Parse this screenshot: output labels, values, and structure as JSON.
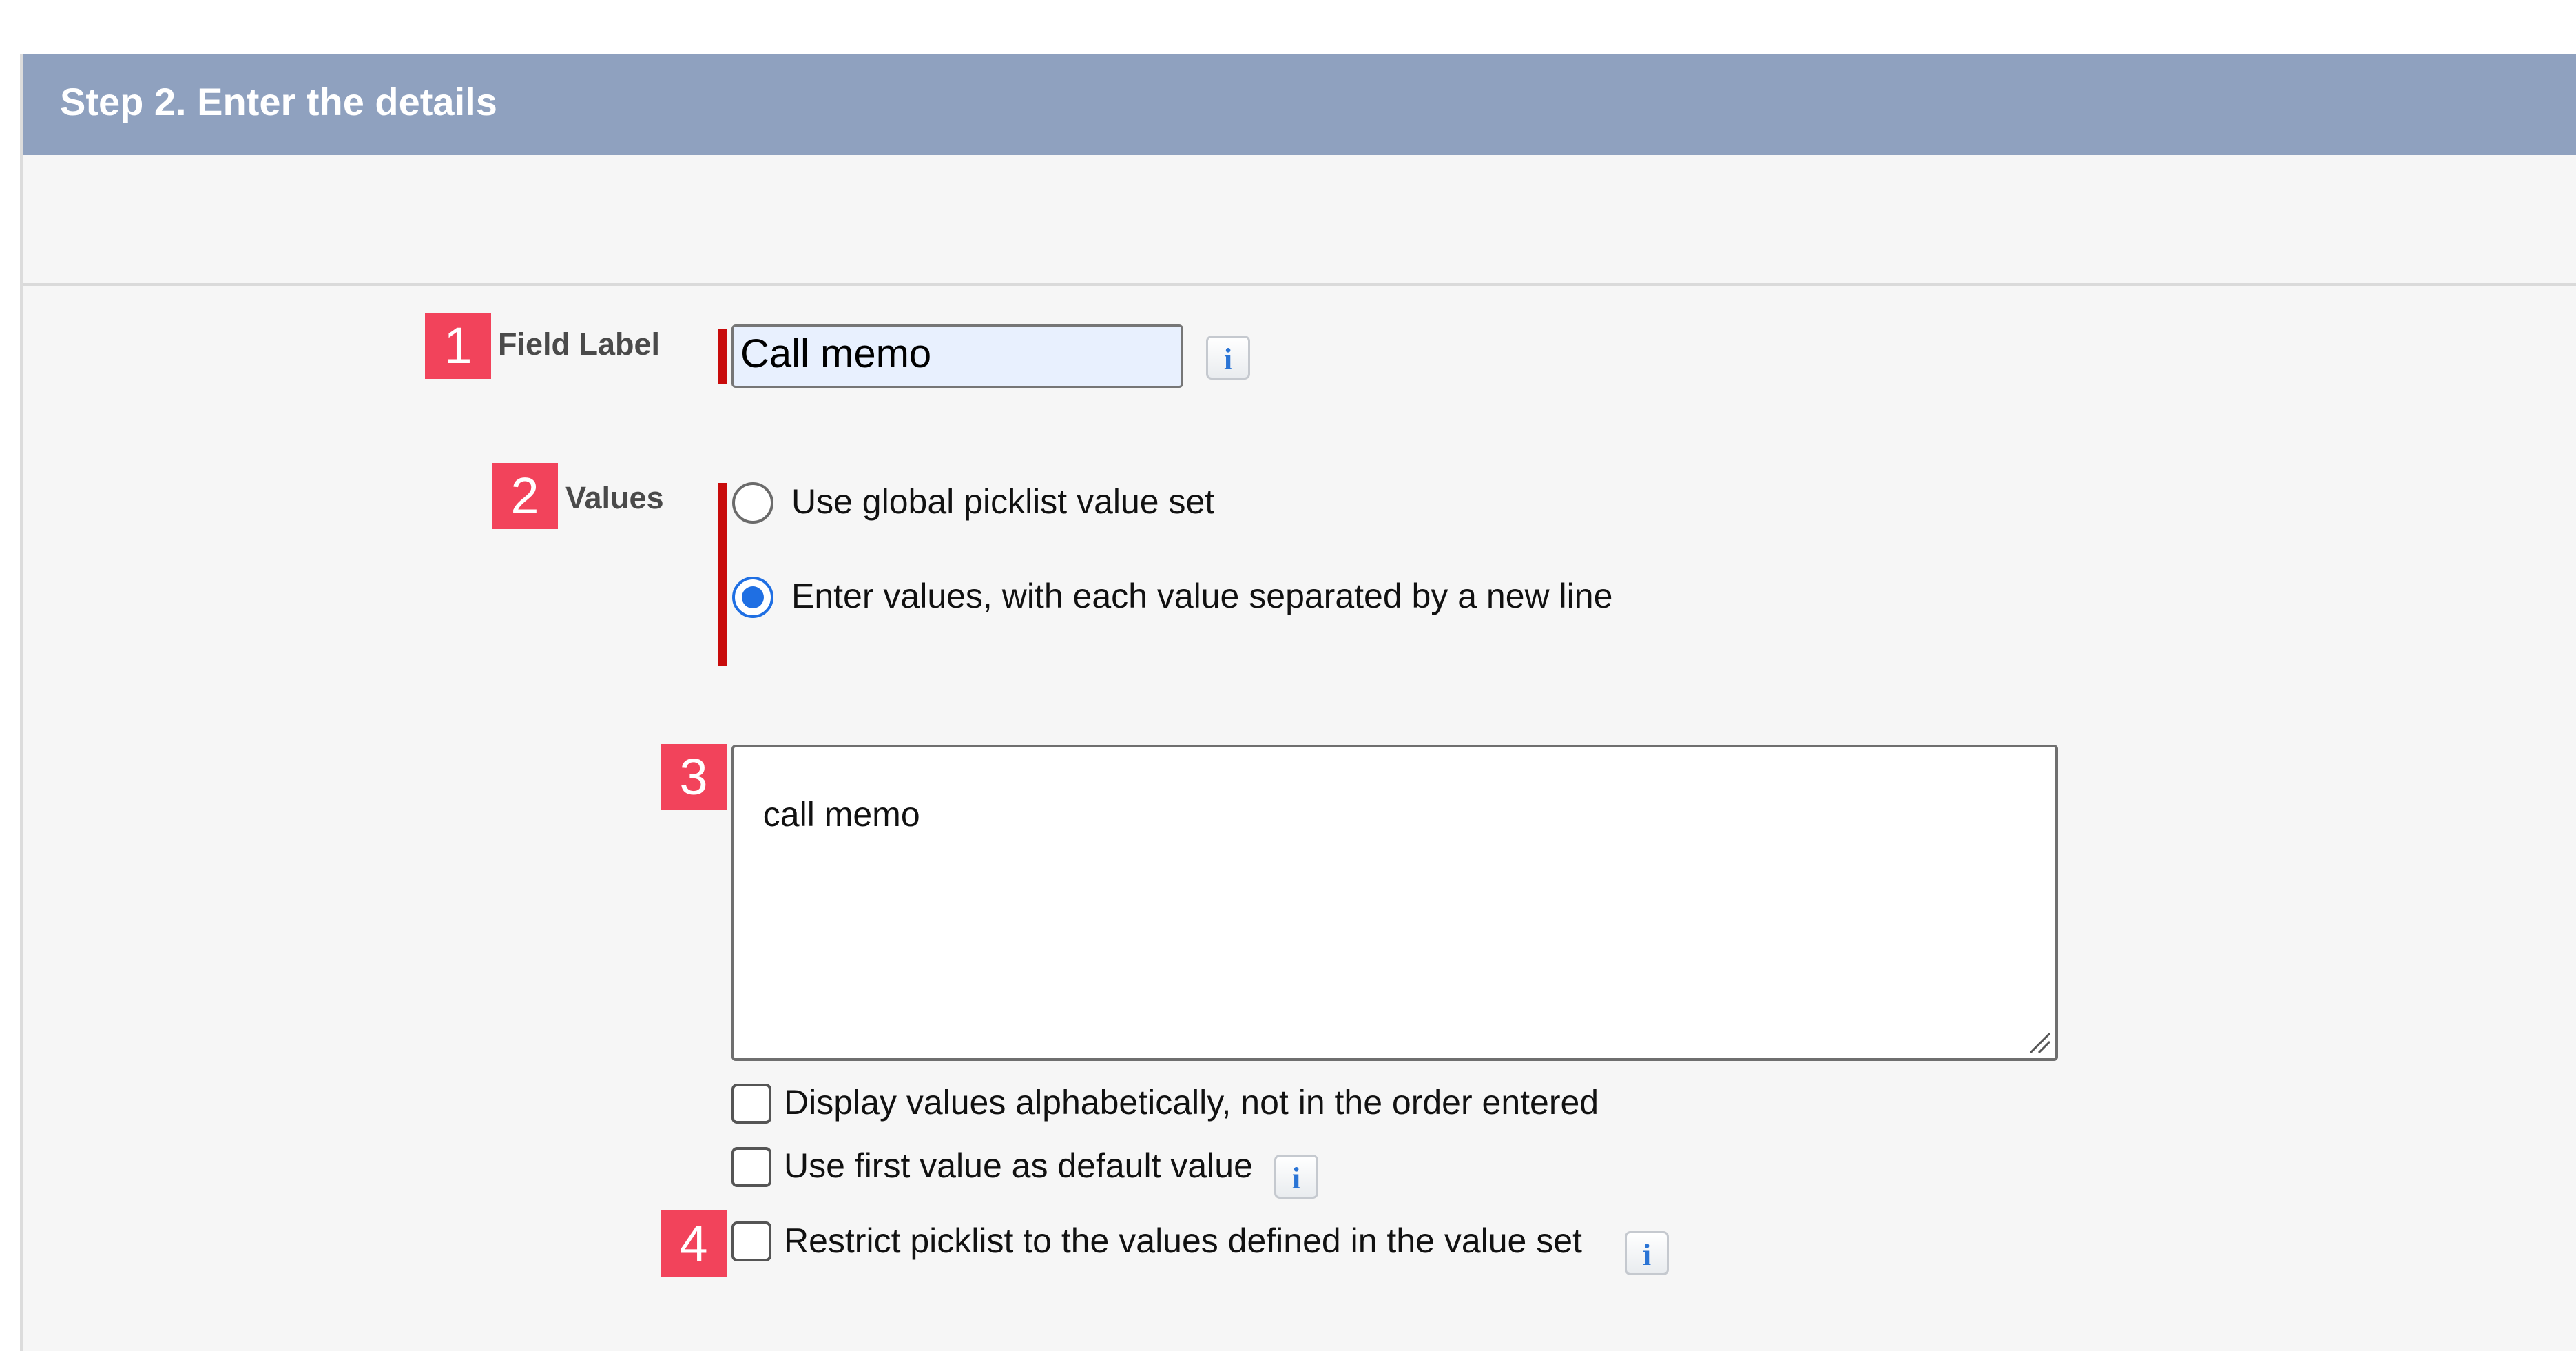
{
  "section": {
    "title": "Step 2. Enter the details"
  },
  "badges": {
    "one": "1",
    "two": "2",
    "three": "3",
    "four": "4"
  },
  "field_label": {
    "label": "Field Label",
    "value": "Call memo",
    "info_icon": "i"
  },
  "values": {
    "label": "Values",
    "options": [
      {
        "label": "Use global picklist value set",
        "selected": false
      },
      {
        "label": "Enter values, with each value separated by a new line",
        "selected": true
      }
    ],
    "textarea_value": "call memo"
  },
  "checkboxes": [
    {
      "label": "Display values alphabetically, not in the order entered",
      "checked": false,
      "has_info": false
    },
    {
      "label": "Use first value as default value",
      "checked": false,
      "has_info": true
    },
    {
      "label": "Restrict picklist to the values defined in the value set",
      "checked": false,
      "has_info": true
    }
  ],
  "icons": {
    "info": "info-icon",
    "radio": "radio-icon",
    "checkbox": "checkbox-icon",
    "grip": "resize-grip-icon"
  },
  "colors": {
    "header_bg": "#8fa1bf",
    "badge": "#f2435b",
    "required": "#c80b0b",
    "radio_selected": "#1f6fe3",
    "input_bg": "#e8f0fe"
  }
}
